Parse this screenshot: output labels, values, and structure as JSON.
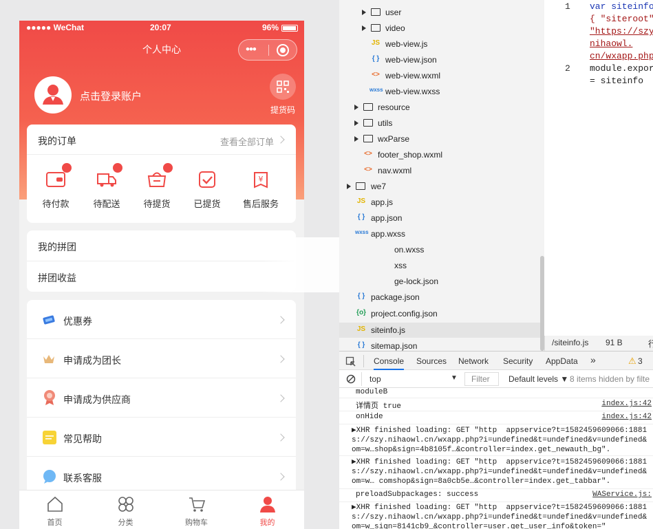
{
  "status_bar": {
    "carrier": "●●●●● WeChat",
    "time": "20:07",
    "battery": "96%"
  },
  "nav": {
    "title": "个人中心"
  },
  "profile": {
    "login_text": "点击登录账户",
    "pickup_code": "提货码"
  },
  "orders": {
    "title": "我的订单",
    "view_all": "查看全部订单",
    "items": [
      {
        "label": "待付款",
        "badge": true
      },
      {
        "label": "待配送",
        "badge": true
      },
      {
        "label": "待提货",
        "badge": true
      },
      {
        "label": "已提货",
        "badge": false
      },
      {
        "label": "售后服务",
        "badge": false
      }
    ]
  },
  "group": {
    "items": [
      "我的拼团",
      "拼团收益"
    ]
  },
  "menu": {
    "items": [
      {
        "label": "优惠券",
        "icon": "coupon-icon"
      },
      {
        "label": "申请成为团长",
        "icon": "crown-icon"
      },
      {
        "label": "申请成为供应商",
        "icon": "medal-icon"
      },
      {
        "label": "常见帮助",
        "icon": "help-note-icon"
      },
      {
        "label": "联系客服",
        "icon": "service-chat-icon"
      }
    ]
  },
  "tabbar": {
    "items": [
      {
        "label": "首页",
        "icon": "home-icon"
      },
      {
        "label": "分类",
        "icon": "category-icon"
      },
      {
        "label": "购物车",
        "icon": "cart-icon"
      },
      {
        "label": "我的",
        "icon": "user-icon",
        "active": true
      }
    ]
  },
  "colors": {
    "brand": "#f04a47",
    "devtools_accent": "#1a73e8"
  },
  "devtools": {
    "tree": [
      {
        "name": "user",
        "type": "folder"
      },
      {
        "name": "video",
        "type": "folder"
      },
      {
        "name": "web-view.js",
        "type": "js"
      },
      {
        "name": "web-view.json",
        "type": "json"
      },
      {
        "name": "web-view.wxml",
        "type": "wxml"
      },
      {
        "name": "web-view.wxss",
        "type": "wxss"
      },
      {
        "name": "resource",
        "type": "folder"
      },
      {
        "name": "utils",
        "type": "folder"
      },
      {
        "name": "wxParse",
        "type": "folder"
      },
      {
        "name": "footer_shop.wxml",
        "type": "wxml"
      },
      {
        "name": "nav.wxml",
        "type": "wxml"
      },
      {
        "name": "we7",
        "type": "folder"
      },
      {
        "name": "app.js",
        "type": "js"
      },
      {
        "name": "app.json",
        "type": "json"
      },
      {
        "name": "app.wxss",
        "type": "wxss"
      },
      {
        "name": "on.wxss",
        "type": "wxss"
      },
      {
        "name": "xss",
        "type": "wxss"
      },
      {
        "name": "ge-lock.json",
        "type": "json"
      },
      {
        "name": "package.json",
        "type": "json"
      },
      {
        "name": "project.config.json",
        "type": "config"
      },
      {
        "name": "siteinfo.js",
        "type": "js"
      },
      {
        "name": "sitemap.json",
        "type": "json"
      }
    ],
    "editor": {
      "line1": "1",
      "line2": "2",
      "code": [
        "var siteinfo",
        "{ \"siteroot\"",
        "\"https://szy",
        "nihaowl.",
        "cn/wxapp.php",
        "module.expor",
        "= siteinfo"
      ]
    },
    "file_status": {
      "name": "/siteinfo.js",
      "size": "91 B",
      "extra": "行"
    },
    "tabs": [
      "Console",
      "Sources",
      "Network",
      "Security",
      "AppData"
    ],
    "more": "»",
    "warnings": "3",
    "console_toolbar": {
      "context": "top",
      "filter_placeholder": "Filter",
      "levels": "Default levels ▼",
      "hidden": "8 items hidden by filte"
    },
    "logs": [
      {
        "msg": "moduleB",
        "src": ""
      },
      {
        "msg": "详情页 true",
        "src": "index.js:42"
      },
      {
        "msg": "onHide",
        "src": "index.js:42"
      },
      {
        "msg": "▶XHR finished loading: GET \"http  appservice?t=1582459609066:1881\ns://szy.nihaowl.cn/wxapp.php?i=undefined&t=undefined&v=undefined&\nom=w…shop&sign=4b8105f…&controller=index.get_newauth_bg\".",
        "src": ""
      },
      {
        "msg": "▶XHR finished loading: GET \"http  appservice?t=1582459609066:1881\ns://szy.nihaowl.cn/wxapp.php?i=undefined&t=undefined&v=undefined&\nom=w… comshop&sign=8a0cb5e…&controller=index.get_tabbar\".",
        "src": ""
      },
      {
        "msg": "preloadSubpackages: success",
        "src": "WAService.js:"
      },
      {
        "msg": "▶XHR finished loading: GET \"http  appservice?t=1582459609066:1881\ns://szy.nihaowl.cn/wxapp.php?i=undefined&t=undefined&v=undefined&\nom=w_sign=8141cb9_&controller=user.get_user_info&token=\"",
        "src": ""
      }
    ]
  }
}
